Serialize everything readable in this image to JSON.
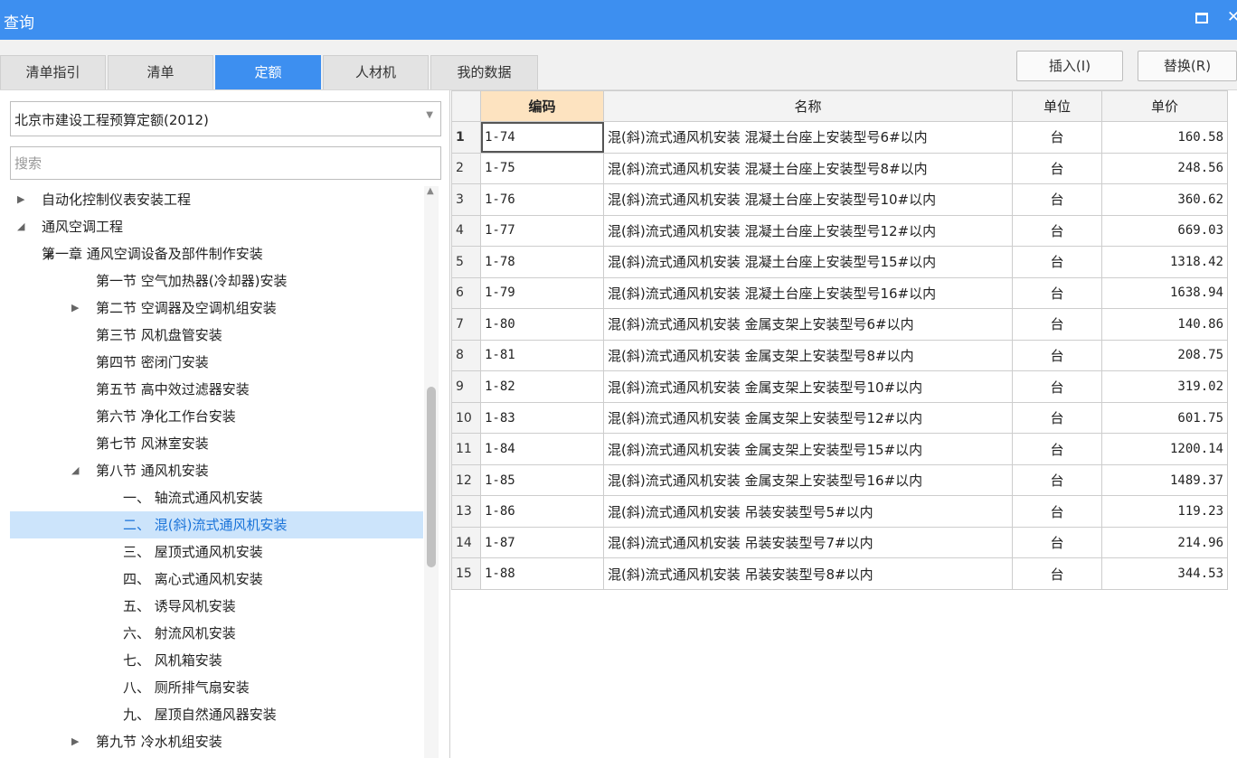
{
  "window": {
    "title": "查询",
    "maximize_glyph": "maximize-icon",
    "close_glyph": "close-icon"
  },
  "tabs": [
    {
      "label": "清单指引",
      "active": false
    },
    {
      "label": "清单",
      "active": false
    },
    {
      "label": "定额",
      "active": true
    },
    {
      "label": "人材机",
      "active": false
    },
    {
      "label": "我的数据",
      "active": false
    }
  ],
  "actions": {
    "insert": "插入(I)",
    "replace": "替换(R)"
  },
  "left": {
    "dropdown_value": "北京市建设工程预算定额(2012)",
    "search_placeholder": "搜索",
    "tree": [
      {
        "label": "自动化控制仪表安装工程",
        "level": 0,
        "toggle": "collapsed"
      },
      {
        "label": "通风空调工程",
        "level": 0,
        "toggle": "expanded"
      },
      {
        "label": "第一章 通风空调设备及部件制作安装",
        "level": 1,
        "toggle": "expanded"
      },
      {
        "label": "第一节 空气加热器(冷却器)安装",
        "level": 2,
        "toggle": "none"
      },
      {
        "label": "第二节 空调器及空调机组安装",
        "level": 2,
        "toggle": "collapsed"
      },
      {
        "label": "第三节 风机盘管安装",
        "level": 2,
        "toggle": "none"
      },
      {
        "label": "第四节 密闭门安装",
        "level": 2,
        "toggle": "none"
      },
      {
        "label": "第五节 高中效过滤器安装",
        "level": 2,
        "toggle": "none"
      },
      {
        "label": "第六节 净化工作台安装",
        "level": 2,
        "toggle": "none"
      },
      {
        "label": "第七节 风淋室安装",
        "level": 2,
        "toggle": "none"
      },
      {
        "label": "第八节 通风机安装",
        "level": 2,
        "toggle": "expanded"
      },
      {
        "label": "一、 轴流式通风机安装",
        "level": 3,
        "toggle": "none"
      },
      {
        "label": "二、 混(斜)流式通风机安装",
        "level": 3,
        "toggle": "none",
        "selected": true
      },
      {
        "label": "三、 屋顶式通风机安装",
        "level": 3,
        "toggle": "none"
      },
      {
        "label": "四、 离心式通风机安装",
        "level": 3,
        "toggle": "none"
      },
      {
        "label": "五、 诱导风机安装",
        "level": 3,
        "toggle": "none"
      },
      {
        "label": "六、 射流风机安装",
        "level": 3,
        "toggle": "none"
      },
      {
        "label": "七、 风机箱安装",
        "level": 3,
        "toggle": "none"
      },
      {
        "label": "八、 厕所排气扇安装",
        "level": 3,
        "toggle": "none"
      },
      {
        "label": "九、 屋顶自然通风器安装",
        "level": 3,
        "toggle": "none"
      },
      {
        "label": "第九节 冷水机组安装",
        "level": 2,
        "toggle": "collapsed"
      }
    ]
  },
  "grid": {
    "columns": [
      "编码",
      "名称",
      "单位",
      "单价"
    ],
    "rows": [
      {
        "n": "1",
        "code": "1-74",
        "name": "混(斜)流式通风机安装 混凝土台座上安装型号6#以内",
        "unit": "台",
        "price": "160.58"
      },
      {
        "n": "2",
        "code": "1-75",
        "name": "混(斜)流式通风机安装 混凝土台座上安装型号8#以内",
        "unit": "台",
        "price": "248.56"
      },
      {
        "n": "3",
        "code": "1-76",
        "name": "混(斜)流式通风机安装 混凝土台座上安装型号10#以内",
        "unit": "台",
        "price": "360.62"
      },
      {
        "n": "4",
        "code": "1-77",
        "name": "混(斜)流式通风机安装 混凝土台座上安装型号12#以内",
        "unit": "台",
        "price": "669.03"
      },
      {
        "n": "5",
        "code": "1-78",
        "name": "混(斜)流式通风机安装 混凝土台座上安装型号15#以内",
        "unit": "台",
        "price": "1318.42"
      },
      {
        "n": "6",
        "code": "1-79",
        "name": "混(斜)流式通风机安装 混凝土台座上安装型号16#以内",
        "unit": "台",
        "price": "1638.94"
      },
      {
        "n": "7",
        "code": "1-80",
        "name": "混(斜)流式通风机安装 金属支架上安装型号6#以内",
        "unit": "台",
        "price": "140.86"
      },
      {
        "n": "8",
        "code": "1-81",
        "name": "混(斜)流式通风机安装 金属支架上安装型号8#以内",
        "unit": "台",
        "price": "208.75"
      },
      {
        "n": "9",
        "code": "1-82",
        "name": "混(斜)流式通风机安装 金属支架上安装型号10#以内",
        "unit": "台",
        "price": "319.02"
      },
      {
        "n": "10",
        "code": "1-83",
        "name": "混(斜)流式通风机安装 金属支架上安装型号12#以内",
        "unit": "台",
        "price": "601.75"
      },
      {
        "n": "11",
        "code": "1-84",
        "name": "混(斜)流式通风机安装 金属支架上安装型号15#以内",
        "unit": "台",
        "price": "1200.14"
      },
      {
        "n": "12",
        "code": "1-85",
        "name": "混(斜)流式通风机安装 金属支架上安装型号16#以内",
        "unit": "台",
        "price": "1489.37"
      },
      {
        "n": "13",
        "code": "1-86",
        "name": "混(斜)流式通风机安装 吊装安装型号5#以内",
        "unit": "台",
        "price": "119.23"
      },
      {
        "n": "14",
        "code": "1-87",
        "name": "混(斜)流式通风机安装 吊装安装型号7#以内",
        "unit": "台",
        "price": "214.96"
      },
      {
        "n": "15",
        "code": "1-88",
        "name": "混(斜)流式通风机安装 吊装安装型号8#以内",
        "unit": "台",
        "price": "344.53"
      }
    ]
  },
  "colors": {
    "accent": "#3d8ff0",
    "selected_bg": "#cce4fb",
    "header_highlight": "#fde3c0"
  }
}
